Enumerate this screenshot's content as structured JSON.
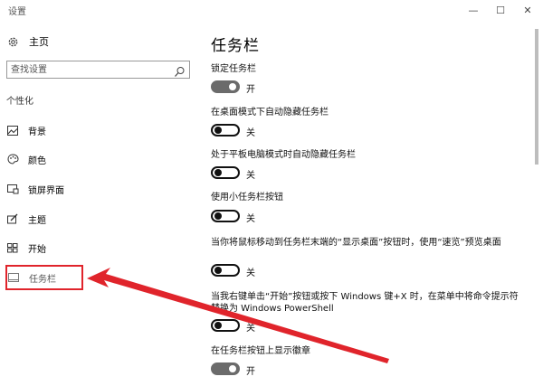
{
  "window": {
    "title": "设置",
    "controls": {
      "minimize": "—",
      "maximize": "☐",
      "close": "✕"
    }
  },
  "sidebar": {
    "home": {
      "label": "主页",
      "icon": "gear-icon"
    },
    "search": {
      "placeholder": "查找设置",
      "icon": "search-icon"
    },
    "section_header": "个性化",
    "items": [
      {
        "label": "背景",
        "icon": "picture-icon",
        "active": false
      },
      {
        "label": "颜色",
        "icon": "palette-icon",
        "active": false
      },
      {
        "label": "锁屏界面",
        "icon": "lock-screen-icon",
        "active": false
      },
      {
        "label": "主题",
        "icon": "theme-brush-icon",
        "active": false
      },
      {
        "label": "开始",
        "icon": "start-grid-icon",
        "active": false
      },
      {
        "label": "任务栏",
        "icon": "taskbar-icon",
        "active": true
      }
    ]
  },
  "main": {
    "title": "任务栏",
    "settings": [
      {
        "label": "锁定任务栏",
        "state": "开",
        "on": true
      },
      {
        "label": "在桌面模式下自动隐藏任务栏",
        "state": "关",
        "on": false
      },
      {
        "label": "处于平板电脑模式时自动隐藏任务栏",
        "state": "关",
        "on": false
      },
      {
        "label": "使用小任务栏按钮",
        "state": "关",
        "on": false
      },
      {
        "label": "当你将鼠标移动到任务栏末端的“显示桌面”按钮时，使用“速览”预览桌面",
        "state": "关",
        "on": false
      },
      {
        "label": "当我右键单击“开始”按钮或按下 Windows 键+X 时，在菜单中将命令提示符替换为 Windows PowerShell",
        "state": "关",
        "on": false
      },
      {
        "label": "在任务栏按钮上显示徽章",
        "state": "开",
        "on": true
      }
    ]
  },
  "colors": {
    "highlight_box": "#e0242b",
    "annotation_arrow": "#e0242b",
    "toggle_on": "#6b6b6b",
    "toggle_off_border": "#111111"
  }
}
